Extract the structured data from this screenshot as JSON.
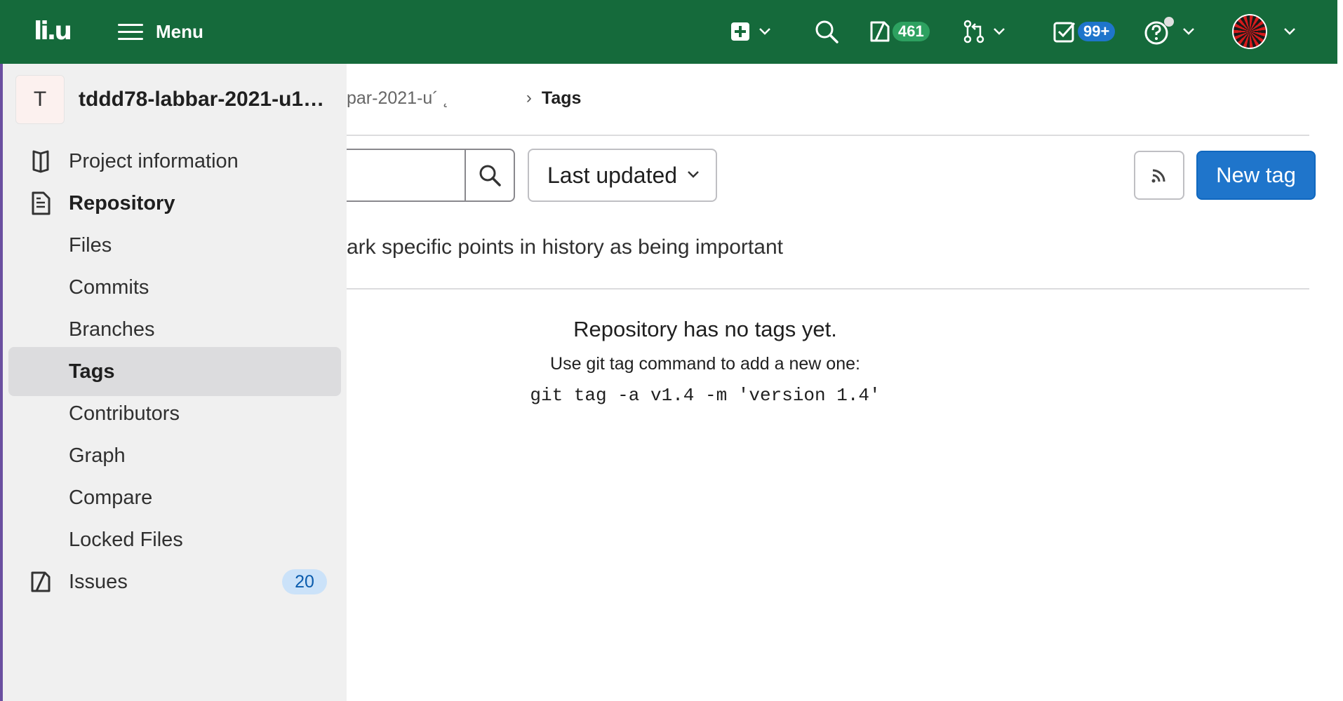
{
  "topbar": {
    "logo_text": "li.u",
    "menu_label": "Menu",
    "issues_count": "461",
    "todos_count": "99+",
    "icons": [
      "plus-square-icon",
      "search-icon",
      "issues-icon",
      "merge-request-icon",
      "todo-icon",
      "help-icon",
      "chevron-down-icon"
    ],
    "colors": {
      "background": "#156a3b",
      "pill_green": "#2da160",
      "pill_blue": "#1f75cb"
    }
  },
  "sidebar": {
    "project_initial": "T",
    "project_name": "tddd78-labbar-2021-u1…",
    "items": [
      {
        "label": "Project information",
        "icon": "project-information-icon"
      },
      {
        "label": "Repository",
        "icon": "repository-icon"
      },
      {
        "label": "Files"
      },
      {
        "label": "Commits"
      },
      {
        "label": "Branches"
      },
      {
        "label": "Tags"
      },
      {
        "label": "Contributors"
      },
      {
        "label": "Graph"
      },
      {
        "label": "Compare"
      },
      {
        "label": "Locked Files"
      },
      {
        "label": "Issues",
        "icon": "issues-icon",
        "badge": "20"
      }
    ],
    "active_item": "Tags"
  },
  "breadcrumb": {
    "partial": "par-2021-u´ ˛",
    "current": "Tags"
  },
  "toolbar": {
    "search_placeholder": "",
    "sort_label": "Last updated",
    "new_tag_label": "New tag"
  },
  "main": {
    "description": "ark specific points in history as being important",
    "empty_title": "Repository has no tags yet.",
    "empty_subtitle": "Use git tag command to add a new one:",
    "empty_command": "git tag -a v1.4 -m 'version 1.4'"
  }
}
